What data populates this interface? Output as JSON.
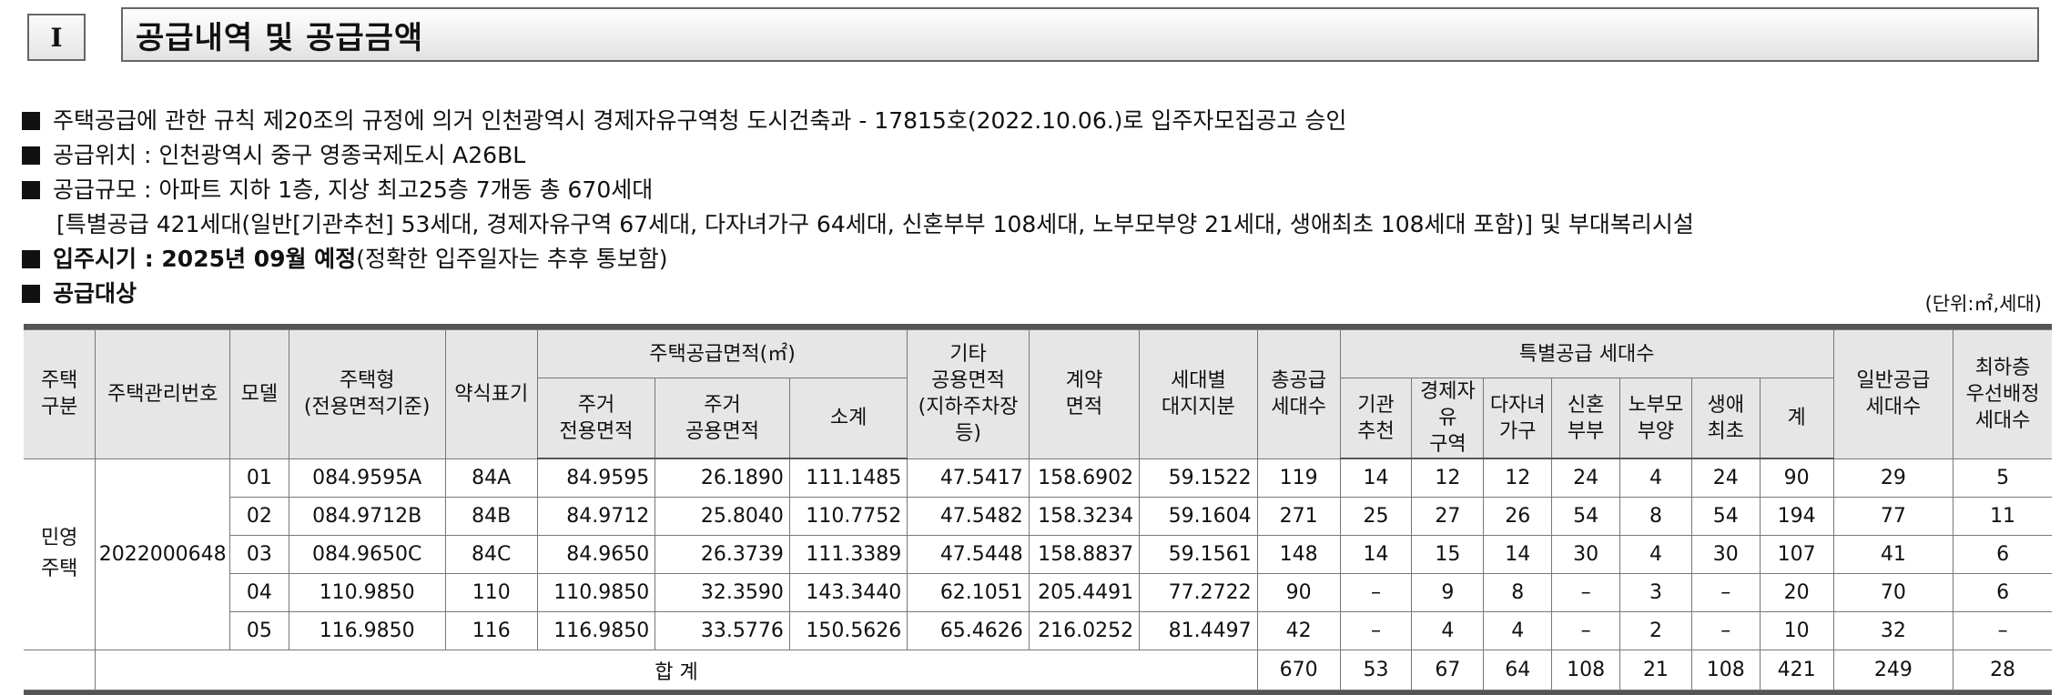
{
  "section": {
    "number": "I",
    "title": "공급내역 및 공급금액"
  },
  "notes": {
    "approval": "주택공급에 관한 규칙 제20조의 규정에 의거 인천광역시 경제자유구역청 도시건축과 - 17815호(2022.10.06.)로 입주자모집공고 승인",
    "location": "공급위치 : 인천광역시 중구 영종국제도시 A26BL",
    "scale": "공급규모 : 아파트 지하 1층, 지상 최고25층 7개동 총 670세대",
    "scale_detail": "[특별공급 421세대(일반[기관추천] 53세대, 경제자유구역 67세대, 다자녀가구 64세대, 신혼부부 108세대, 노부모부양 21세대, 생애최초 108세대 포함)] 및 부대복리시설",
    "move_in_label": "입주시기 : 2025년 09월 예정",
    "move_in_note": "(정확한 입주일자는 추후 통보함)",
    "target_label": "공급대상"
  },
  "unit_label": "(단위:㎡,세대)",
  "table": {
    "headers": {
      "housing_type": "주택\n구분",
      "mgmt_no": "주택관리번호",
      "model": "모델",
      "house_type": "주택형\n(전용면적기준)",
      "short_name": "약식표기",
      "supply_area_group": "주택공급면적(㎡)",
      "exclusive_area": "주거\n전용면적",
      "common_area": "주거\n공용면적",
      "subtotal": "소계",
      "other_common": "기타\n공용면적\n(지하주차장등)",
      "contract_area": "계약\n면적",
      "land_share": "세대별\n대지지분",
      "total_units": "총공급\n세대수",
      "special_group": "특별공급 세대수",
      "sp_agency": "기관\n추천",
      "sp_free_zone": "경제자유\n구역",
      "sp_multi_child": "다자녀\n가구",
      "sp_newlywed": "신혼\n부부",
      "sp_elderly": "노부모\n부양",
      "sp_first_time": "생애\n최초",
      "sp_sum": "계",
      "general_units": "일반공급\n세대수",
      "lowest_floor": "최하층\n우선배정\n세대수"
    },
    "housing_type_value": "민영\n주택",
    "mgmt_no_value": "2022000648",
    "rows": [
      {
        "model": "01",
        "house_type": "084.9595A",
        "short": "84A",
        "excl": "84.9595",
        "common": "26.1890",
        "subtotal": "111.1485",
        "other": "47.5417",
        "contract": "158.6902",
        "land": "59.1522",
        "total": "119",
        "agency": "14",
        "freezone": "12",
        "multichild": "12",
        "newlywed": "24",
        "elderly": "4",
        "first": "24",
        "spsum": "90",
        "general": "29",
        "lowest": "5"
      },
      {
        "model": "02",
        "house_type": "084.9712B",
        "short": "84B",
        "excl": "84.9712",
        "common": "25.8040",
        "subtotal": "110.7752",
        "other": "47.5482",
        "contract": "158.3234",
        "land": "59.1604",
        "total": "271",
        "agency": "25",
        "freezone": "27",
        "multichild": "26",
        "newlywed": "54",
        "elderly": "8",
        "first": "54",
        "spsum": "194",
        "general": "77",
        "lowest": "11"
      },
      {
        "model": "03",
        "house_type": "084.9650C",
        "short": "84C",
        "excl": "84.9650",
        "common": "26.3739",
        "subtotal": "111.3389",
        "other": "47.5448",
        "contract": "158.8837",
        "land": "59.1561",
        "total": "148",
        "agency": "14",
        "freezone": "15",
        "multichild": "14",
        "newlywed": "30",
        "elderly": "4",
        "first": "30",
        "spsum": "107",
        "general": "41",
        "lowest": "6"
      },
      {
        "model": "04",
        "house_type": "110.9850",
        "short": "110",
        "excl": "110.9850",
        "common": "32.3590",
        "subtotal": "143.3440",
        "other": "62.1051",
        "contract": "205.4491",
        "land": "77.2722",
        "total": "90",
        "agency": "–",
        "freezone": "9",
        "multichild": "8",
        "newlywed": "–",
        "elderly": "3",
        "first": "–",
        "spsum": "20",
        "general": "70",
        "lowest": "6"
      },
      {
        "model": "05",
        "house_type": "116.9850",
        "short": "116",
        "excl": "116.9850",
        "common": "33.5776",
        "subtotal": "150.5626",
        "other": "65.4626",
        "contract": "216.0252",
        "land": "81.4497",
        "total": "42",
        "agency": "–",
        "freezone": "4",
        "multichild": "4",
        "newlywed": "–",
        "elderly": "2",
        "first": "–",
        "spsum": "10",
        "general": "32",
        "lowest": "–"
      }
    ],
    "total_row": {
      "label": "합 계",
      "total": "670",
      "agency": "53",
      "freezone": "67",
      "multichild": "64",
      "newlywed": "108",
      "elderly": "21",
      "first": "108",
      "spsum": "421",
      "general": "249",
      "lowest": "28"
    }
  }
}
